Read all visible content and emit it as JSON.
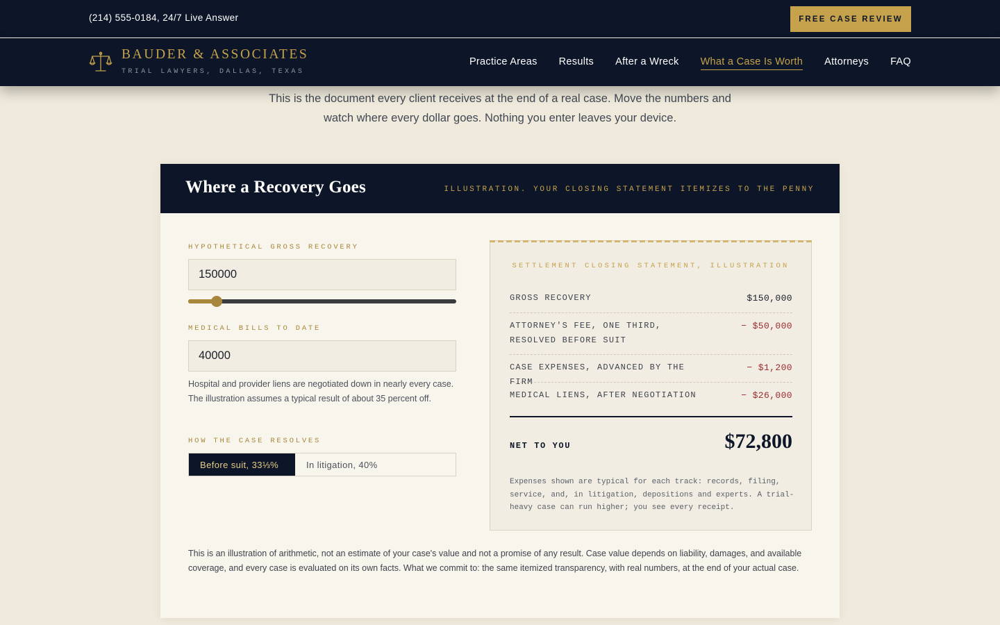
{
  "topbar": {
    "phone": "(214) 555-0184, 24/7 Live Answer",
    "cta_label": "FREE CASE REVIEW"
  },
  "brand": {
    "name": "BAUDER & ASSOCIATES",
    "tagline": "TRIAL LAWYERS, DALLAS, TEXAS",
    "icon": "scales-of-justice-icon"
  },
  "nav": {
    "items": [
      {
        "label": "Practice Areas"
      },
      {
        "label": "Results"
      },
      {
        "label": "After a Wreck"
      },
      {
        "label": "What a Case Is Worth",
        "active": true
      },
      {
        "label": "Attorneys"
      },
      {
        "label": "FAQ"
      }
    ]
  },
  "intro": {
    "text": "This is the document every client receives at the end of a real case. Move the numbers and watch where every dollar goes. Nothing you enter leaves your device."
  },
  "calculator": {
    "title": "Where a Recovery Goes",
    "header_note": "ILLUSTRATION. YOUR CLOSING STATEMENT ITEMIZES TO THE PENNY",
    "gross_label": "HYPOTHETICAL GROSS RECOVERY",
    "gross_value": "150000",
    "slider_fraction": 0.09,
    "medical_label": "MEDICAL BILLS TO DATE",
    "medical_value": "40000",
    "medical_help": "Hospital and provider liens are negotiated down in nearly every case. The illustration assumes a typical result of about 35 percent off.",
    "resolve_label": "HOW THE CASE RESOLVES",
    "resolve_options": [
      {
        "label": "Before suit, 33⅓%",
        "selected": true
      },
      {
        "label": "In litigation, 40%",
        "selected": false
      }
    ],
    "disclaimer": "This is an illustration of arithmetic, not an estimate of your case's value and not a promise of any result. Case value depends on liability, damages, and available coverage, and every case is evaluated on its own facts. What we commit to: the same itemized transparency, with real numbers, at the end of your actual case."
  },
  "statement": {
    "title": "SETTLEMENT CLOSING STATEMENT, ILLUSTRATION",
    "lines": [
      {
        "label": "GROSS RECOVERY",
        "amount": "$150,000"
      },
      {
        "label": "ATTORNEY'S FEE, ONE THIRD, RESOLVED BEFORE SUIT",
        "amount": "− $50,000"
      },
      {
        "label": "CASE EXPENSES, ADVANCED BY THE FIRM",
        "amount": "− $1,200"
      },
      {
        "label": "MEDICAL LIENS, AFTER NEGOTIATION",
        "amount": "− $26,000"
      }
    ],
    "net_label": "NET TO YOU",
    "net_value": "$72,800",
    "note": "Expenses shown are typical for each track: records, filing, service, and, in litigation, depositions and experts. A trial-heavy case can run higher; you see every receipt."
  },
  "colors": {
    "navy": "#0d1628",
    "gold": "#c5a24b",
    "cream": "#efeadc",
    "deduction": "#9e2a2f"
  }
}
